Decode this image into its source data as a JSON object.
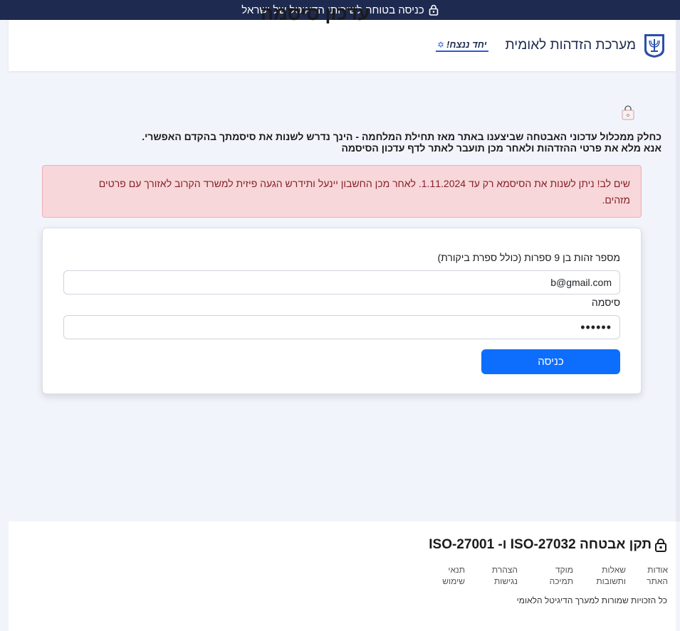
{
  "topbar": {
    "text": "כניסה בטוחה לשירותי הדיגיטל של ישראל",
    "lock_icon": "lock-icon"
  },
  "header": {
    "system_title": "מערכת הזדהות לאומית",
    "badge": "יחד ננצח!",
    "badge_icon": "star-of-david-icon",
    "emblem_icon": "state-emblem-icon"
  },
  "main": {
    "title": "עדכון סיסמה",
    "title_icon": "shopping-bag-icon",
    "intro_line1": "כחלק ממכלול עדכוני האבטחה שביצענו באתר מאז תחילת המלחמה - הינך נדרש לשנות את סיסמתך בהקדם האפשרי.",
    "intro_line2": "אנא מלא את פרטי ההזדהות ולאחר מכן תועבר לאתר לדף עדכון הסיסמה",
    "alert": "שים לב! ניתן לשנות את הסיסמא רק עד 1.11.2024. לאחר מכן החשבון יינעל ותידרש הגעה פיזית למשרד הקרוב לאזורך עם פרטים מזהים."
  },
  "form": {
    "id_label": "מספר זהות בן 9 ספרות (כולל ספרת ביקורת)",
    "id_value": "b@gmail.com",
    "password_label": "סיסמה",
    "password_value": "••••••",
    "submit_label": "כניסה"
  },
  "footer": {
    "title": "תקן אבטחה ISO-27032 ו- ISO-27001",
    "links": [
      [
        "אודות",
        "האתר"
      ],
      [
        "שאלות",
        "ותשובות"
      ],
      [
        "מוקד",
        "תמיכה"
      ],
      [
        "הצהרת",
        "נגישות"
      ],
      [
        "תנאי",
        "שימוש"
      ]
    ],
    "copyright": "כל הזכויות שמורות למערך הדיגיטל הלאומי"
  },
  "colors": {
    "topbar_bg": "#1e2a4f",
    "alert_bg": "#f8d7da",
    "alert_text": "#842029",
    "primary_button": "#0d6efd"
  }
}
